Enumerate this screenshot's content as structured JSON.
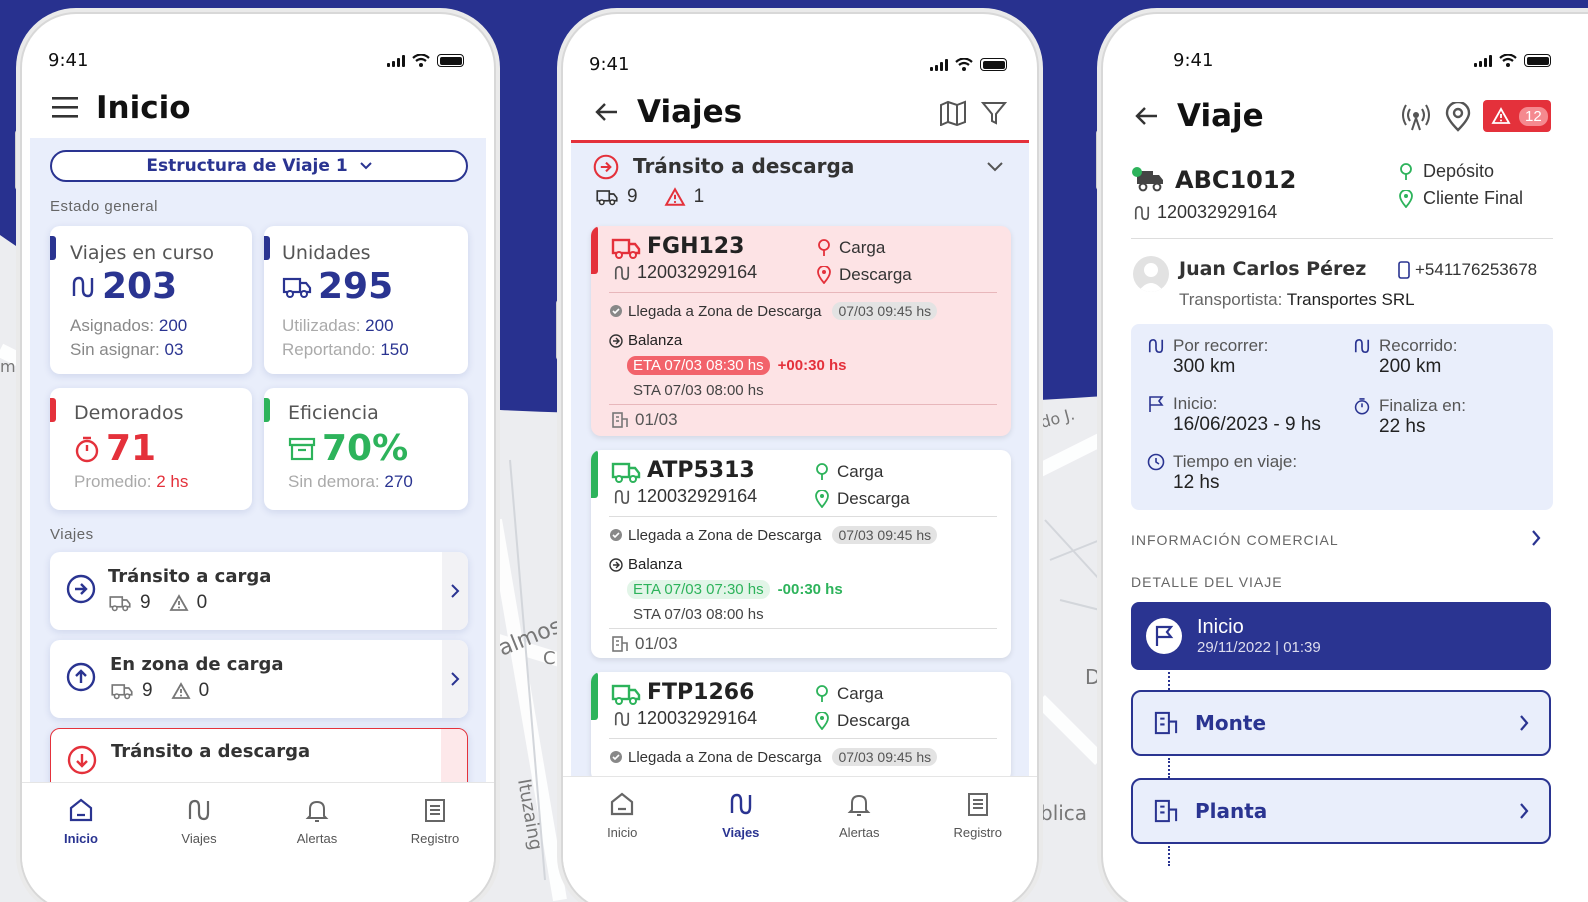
{
  "colors": {
    "navy": "#2a3491",
    "red": "#e4313b",
    "green": "#2db35b",
    "blue_bg": "#2a3491"
  },
  "status": {
    "time1": "9:41",
    "time2": "9:41",
    "time3": "9:41"
  },
  "inicio": {
    "title": "Inicio",
    "structure_select": "Estructura de Viaje 1",
    "section_general": "Estado general",
    "viajes_curso": {
      "label": "Viajes en curso",
      "value": "203",
      "l1": "Asignados:",
      "v1": "200",
      "l2": "Sin asignar:",
      "v2": "03"
    },
    "unidades": {
      "label": "Unidades",
      "value": "295",
      "l1": "Utilizadas:",
      "v1": "200",
      "l2": "Reportando:",
      "v2": "150"
    },
    "demorados": {
      "label": "Demorados",
      "value": "71",
      "l1": "Promedio:",
      "v1": "2 hs"
    },
    "eficiencia": {
      "label": "Eficiencia",
      "value": "70%",
      "l1": "Sin demora:",
      "v1": "270"
    },
    "section_viajes": "Viajes",
    "trips": [
      {
        "name": "Tránsito a carga",
        "units": "9",
        "alerts": "0"
      },
      {
        "name": "En zona de carga",
        "units": "9",
        "alerts": "0"
      },
      {
        "name": "Tránsito a descarga"
      }
    ],
    "nav": [
      "Inicio",
      "Viajes",
      "Alertas",
      "Registro"
    ]
  },
  "viajes": {
    "title": "Viajes",
    "group": {
      "name": "Tránsito a descarga",
      "units": "9",
      "alerts": "1"
    },
    "cards": [
      {
        "plate": "FGH123",
        "id": "120032929164",
        "from": "Carga",
        "to": "Descarga",
        "event": "Llegada a Zona de Descarga",
        "event_time": "07/03 09:45 hs",
        "checkpoint": "Balanza",
        "eta": "ETA 07/03 08:30 hs",
        "delta": "+00:30 hs",
        "sta": "STA 07/03 08:00 hs",
        "date": "01/03"
      },
      {
        "plate": "ATP5313",
        "id": "120032929164",
        "from": "Carga",
        "to": "Descarga",
        "event": "Llegada a Zona de Descarga",
        "event_time": "07/03 09:45 hs",
        "checkpoint": "Balanza",
        "eta": "ETA 07/03 07:30 hs",
        "delta": "-00:30 hs",
        "sta": "STA 07/03 08:00 hs",
        "date": "01/03"
      },
      {
        "plate": "FTP1266",
        "id": "120032929164",
        "from": "Carga",
        "to": "Descarga",
        "event": "Llegada a Zona de Descarga",
        "event_time": "07/03 09:45 hs"
      }
    ],
    "nav": [
      "Inicio",
      "Viajes",
      "Alertas",
      "Registro"
    ]
  },
  "viaje": {
    "title": "Viaje",
    "alert_count": "12",
    "plate": "ABC1012",
    "id": "120032929164",
    "origin": "Depósito",
    "destination": "Cliente Final",
    "driver": "Juan Carlos Pérez",
    "phone": "+541176253678",
    "carrier_label": "Transportista:",
    "carrier": "Transportes SRL",
    "stats": {
      "por_recorrer_l": "Por recorrer:",
      "por_recorrer": "300 km",
      "recorrido_l": "Recorrido:",
      "recorrido": "200 km",
      "inicio_l": "Inicio:",
      "inicio": "16/06/2023 - 9 hs",
      "finaliza_l": "Finaliza en:",
      "finaliza": "22 hs",
      "tiempo_l": "Tiempo en viaje:",
      "tiempo": "12 hs"
    },
    "info_comercial": "INFORMACIÓN COMERCIAL",
    "detalle": "DETALLE DEL VIAJE",
    "steps": [
      {
        "name": "Inicio",
        "time": "29/11/2022 | 01:39"
      },
      {
        "name": "Monte"
      },
      {
        "name": "Planta"
      }
    ],
    "map_labels": [
      "mi",
      "do J",
      "almos",
      "Ituzaing",
      "C",
      "D",
      "blica"
    ]
  }
}
